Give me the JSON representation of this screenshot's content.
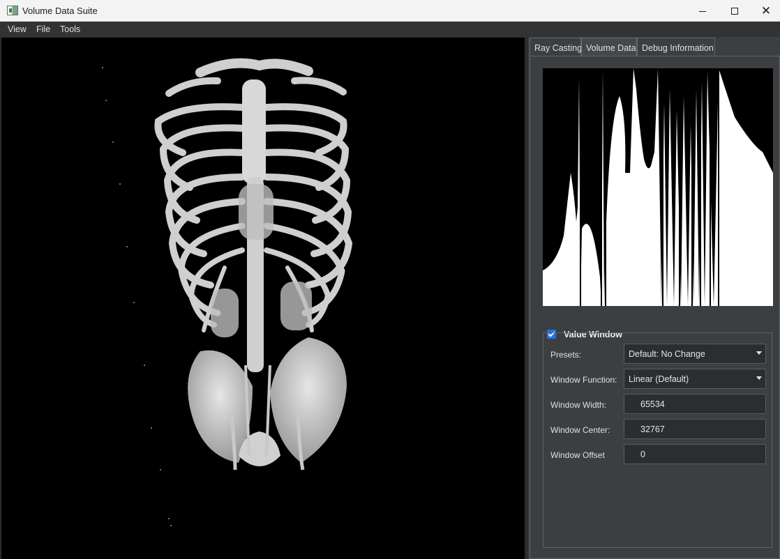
{
  "window": {
    "title": "Volume Data Suite"
  },
  "menu": {
    "items": [
      "View",
      "File",
      "Tools"
    ]
  },
  "tabs": [
    {
      "label": "Ray Casting",
      "active": false
    },
    {
      "label": "Volume Data",
      "active": true
    },
    {
      "label": "Debug Information",
      "active": false
    }
  ],
  "value_window": {
    "enabled_label": "Value Window",
    "checked": true,
    "presets": {
      "label": "Presets:",
      "value": "Default: No Change"
    },
    "window_function": {
      "label": "Window Function:",
      "value": "Linear (Default)"
    },
    "window_width": {
      "label": "Window Width:",
      "value": "65534"
    },
    "window_center": {
      "label": "Window Center:",
      "value": "32767"
    },
    "window_offset": {
      "label": "Window Offset",
      "value": "0"
    }
  },
  "colors": {
    "accent": "#1e73e8",
    "panel_bg": "#3c3f41",
    "viewport_bg": "#000000"
  }
}
